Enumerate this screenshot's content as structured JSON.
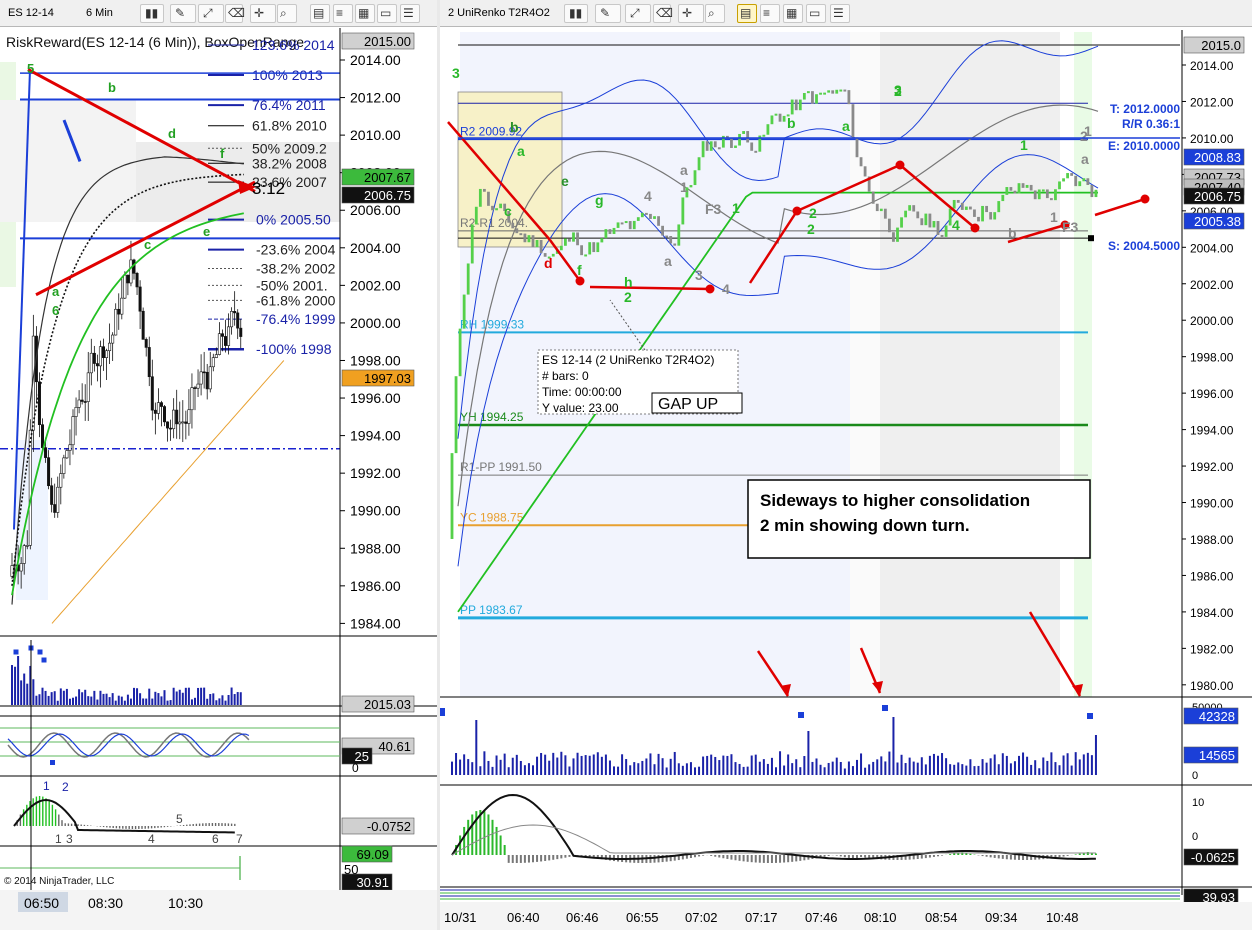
{
  "left": {
    "toolbar": {
      "instrument": "ES 12-14",
      "interval": "6 Min"
    },
    "indicator_title": "RiskReward(ES 12-14 (6 Min)), BoxOpenRange",
    "copyright": "© 2014 NinjaTrader, LLC",
    "countdown": "3:12"
  },
  "right": {
    "toolbar": {
      "instrument": "2 UniRenko T2R4O2"
    },
    "target_label": "T: 2012.0000",
    "rr_label": "R/R 0.36:1",
    "entry_label": "E: 2010.0000",
    "stop_label": "S: 2004.5000",
    "gap_label": "GAP UP",
    "tooltip_lines": [
      "ES 12-14 (2 UniRenko T2R4O2)",
      "# bars:   0",
      "Time:     00:00:00",
      "Y value:  23.00"
    ],
    "annotation_lines": [
      "Sideways to higher consolidation",
      "2 min showing down turn."
    ]
  },
  "colors": {
    "fib": "#1a22a8",
    "trend": "#e00000",
    "bull": "#22c022",
    "bear": "#333333",
    "renko_bull": "#55d04a",
    "renko_bear": "#8a8a8a",
    "band": "#1b3fd8",
    "cyan": "#22aadd",
    "green_level": "#1a8a1a",
    "orange": "#e8a030",
    "badge_dark": "#111111",
    "badge_green": "#3cba3c",
    "badge_orange": "#f0a020",
    "badge_blue": "#1b3fd8",
    "badge_gray": "#8a8a8a"
  },
  "chart_data": [
    {
      "type": "candlestick",
      "title": "ES 12-14 6 Min",
      "y_ticks": [
        2014,
        2012,
        2010,
        2008,
        2006,
        2004,
        2002,
        2000,
        1998,
        1996,
        1994,
        1992,
        1990,
        1988,
        1986,
        1984
      ],
      "ylim": [
        1983,
        2015.5
      ],
      "x_ticks": [
        "06:50",
        "08:30",
        "10:30"
      ],
      "price_badges": {
        "high": "2015.00",
        "mid": "2007.67",
        "last": "2006.75",
        "low": "1997.03"
      },
      "fib_levels": [
        {
          "label": "123.6% 2014",
          "price": 2014.8
        },
        {
          "label": "100% 2013",
          "price": 2013.2
        },
        {
          "label": "76.4% 2011",
          "price": 2011.6
        },
        {
          "label": "61.8% 2010",
          "price": 2010.5
        },
        {
          "label": "50% 2009.2",
          "price": 2009.3
        },
        {
          "label": "38.2% 2008",
          "price": 2008.5
        },
        {
          "label": "23.6% 2007",
          "price": 2007.5
        },
        {
          "label": "0% 2005.50",
          "price": 2005.5
        },
        {
          "label": "-23.6% 2004",
          "price": 2003.9
        },
        {
          "label": "-38.2% 2002",
          "price": 2002.9
        },
        {
          "label": "-50% 2001.",
          "price": 2002.0
        },
        {
          "label": "-61.8% 2000",
          "price": 2001.2
        },
        {
          "label": "-76.4% 1999",
          "price": 2000.2
        },
        {
          "label": "-100% 1998",
          "price": 1998.6
        }
      ],
      "swing_labels": [
        "5",
        "b",
        "d",
        "f",
        "a",
        "c",
        "e",
        "6"
      ],
      "volume_badge": "2015.03",
      "oscillator_badges": [
        "40.61",
        "25"
      ],
      "oscillator_ticks": [
        "0"
      ],
      "macd_badge": "-0.0752",
      "macd_labels": [
        "1",
        "2",
        "1",
        "3",
        "4",
        "5",
        "6",
        "7"
      ],
      "rsi_badges": [
        "69.09",
        "30.91"
      ],
      "rsi_ticks": [
        "50"
      ]
    },
    {
      "type": "renko",
      "title": "ES 12-14 2 UniRenko T2R4O2",
      "y_ticks": [
        2014,
        2012,
        2010,
        2008,
        2006,
        2004,
        2002,
        2000,
        1998,
        1996,
        1994,
        1992,
        1990,
        1988,
        1986,
        1984,
        1982,
        1980
      ],
      "ylim": [
        1979,
        2015.5
      ],
      "x_ticks": [
        "10/31",
        "06:40",
        "06:46",
        "06:55",
        "07:02",
        "07:17",
        "07:46",
        "08:10",
        "08:54",
        "09:34",
        "10:48"
      ],
      "price_badges": [
        "2015.0",
        "2008.83",
        "2007.73",
        "2007.40",
        "2006.75",
        "2005.38"
      ],
      "level_lines": [
        {
          "label": "R2-R1 2004.",
          "price": 2004.9
        },
        {
          "label": "R2 2009.92",
          "price": 2009.92
        },
        {
          "label": "RH 1999.33",
          "price": 1999.33
        },
        {
          "label": "YH 1994.25",
          "price": 1994.25
        },
        {
          "label": "R1-PP 1991.50",
          "price": 1991.5
        },
        {
          "label": "YC 1988.75",
          "price": 1988.75
        },
        {
          "label": "PP 1983.67",
          "price": 1983.67
        }
      ],
      "swing_labels": [
        "3",
        "b",
        "a",
        "c",
        "d",
        "e",
        "f",
        "g",
        "h",
        "4",
        "2",
        "a",
        "1",
        "a",
        "F3",
        "3",
        "4",
        "1",
        "b",
        "a",
        "2",
        "3",
        "4",
        "2",
        "1",
        "b",
        "1",
        "F3",
        "2",
        "a",
        "1",
        "2"
      ],
      "volume_ticks": [
        "50000",
        "0"
      ],
      "volume_badges": [
        "42328",
        "14565"
      ],
      "macd_ticks": [
        "10",
        "0"
      ],
      "macd_badge": "-0.0625",
      "bottom_badge": "39.93"
    }
  ]
}
